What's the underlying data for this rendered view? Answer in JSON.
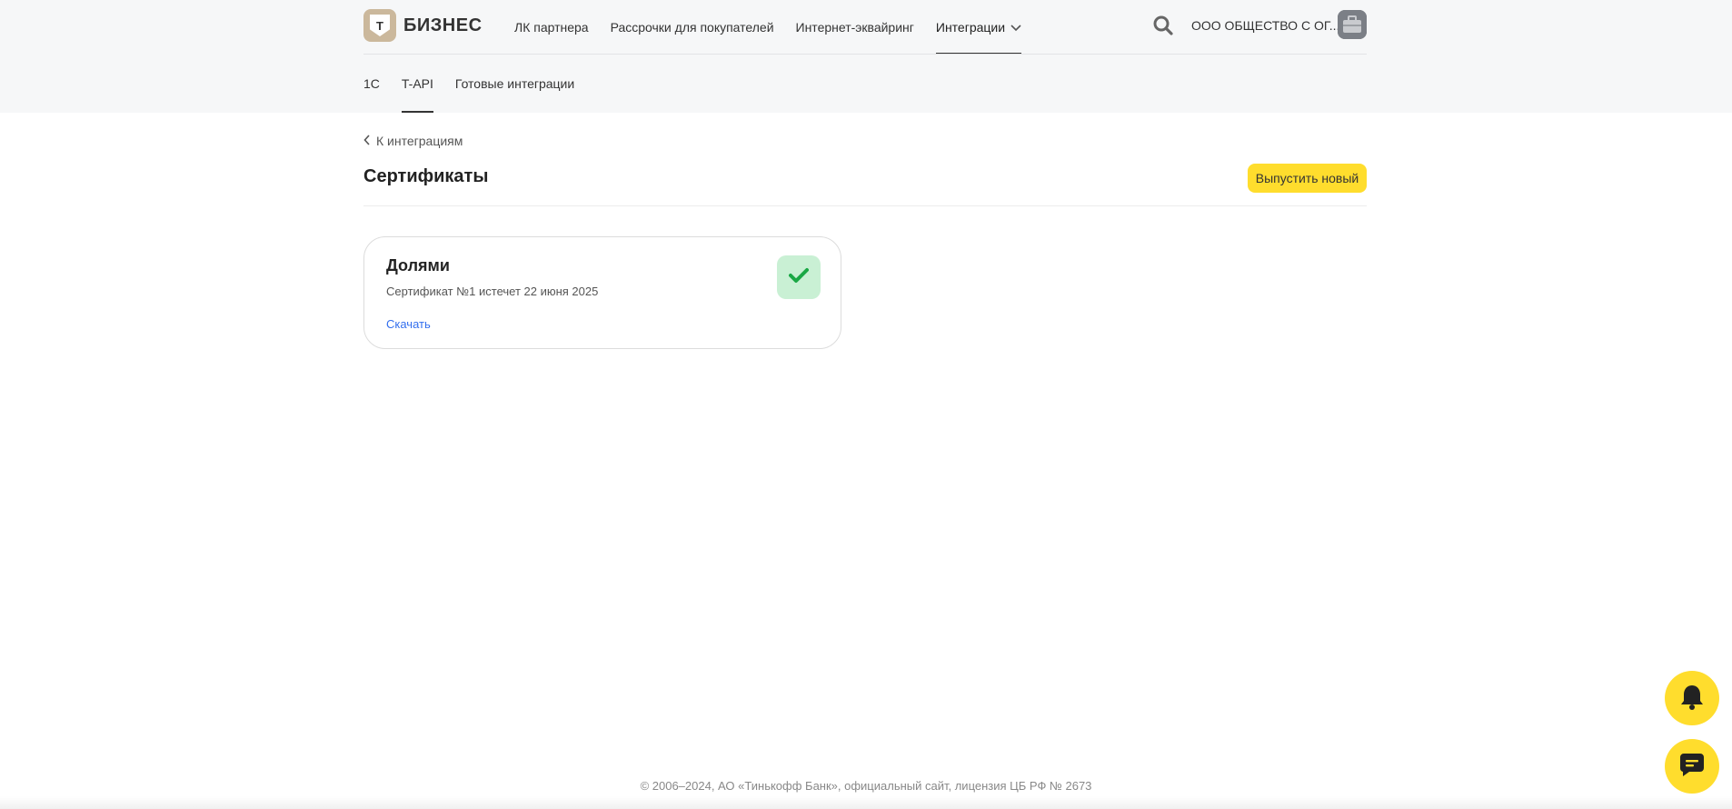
{
  "header": {
    "logo_letter": "Т",
    "logo_text": "БИЗНЕС",
    "nav": [
      {
        "label": "ЛК партнера"
      },
      {
        "label": "Рассрочки для покупателей"
      },
      {
        "label": "Интернет-эквайринг"
      },
      {
        "label": "Интеграции",
        "active": true,
        "has_dropdown": true
      }
    ],
    "org_name": "ООО ОБЩЕСТВО С ОГ...",
    "icons": {
      "search": "search-icon",
      "avatar": "briefcase-avatar",
      "dropdown": "chevron-down-icon"
    }
  },
  "subnav": [
    {
      "label": "1С"
    },
    {
      "label": "T-API",
      "active": true
    },
    {
      "label": "Готовые интеграции"
    }
  ],
  "back_link": {
    "label": "К интеграциям",
    "icon": "chevron-left-icon"
  },
  "page": {
    "title": "Сертификаты",
    "primary_button": "Выпустить новый"
  },
  "certificate_card": {
    "title": "Долями",
    "subtitle": "Сертификат №1 истечет 22 июня 2025",
    "download_link": "Скачать",
    "status_icon": "check-icon"
  },
  "floating_buttons": [
    {
      "icon": "bell-icon"
    },
    {
      "icon": "chat-icon"
    }
  ],
  "footer": {
    "text": "© 2006–2024, АО «Тинькофф Банк», официальный сайт, лицензия ЦБ РФ № 2673"
  },
  "colors": {
    "accent_yellow": "#ffdd2d",
    "link_blue": "#336fee",
    "success_bg": "#c9f0d4",
    "success_icon": "#1aa845",
    "header_bg": "#f6f7f8",
    "logo_bg": "#cbb89c"
  }
}
